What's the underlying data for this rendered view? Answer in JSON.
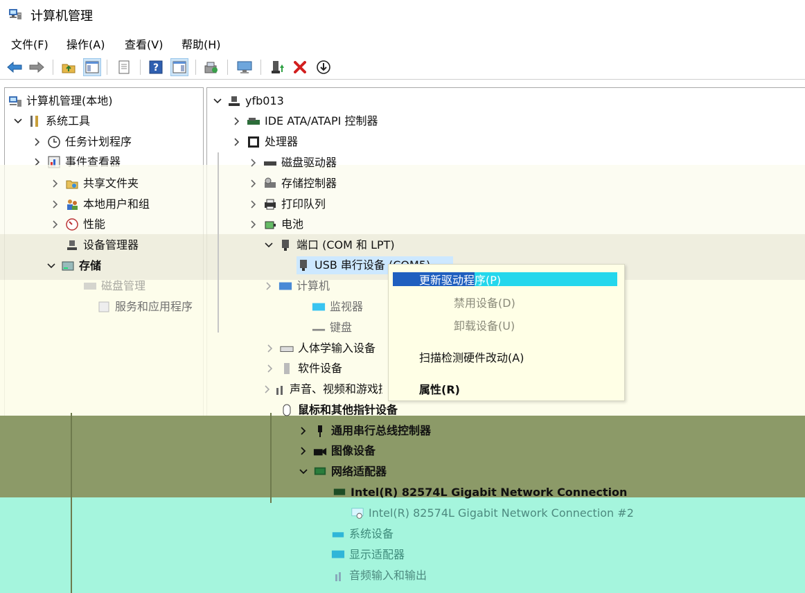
{
  "window": {
    "title": "计算机管理"
  },
  "menu": [
    "文件(F)",
    "操作(A)",
    "查看(V)",
    "帮助(H)"
  ],
  "toolbar": {
    "buttons": [
      "back-icon",
      "forward-icon",
      "up-folder-icon",
      "show-hide-tree-icon",
      "export-list-icon",
      "help-icon",
      "action-pane-icon",
      "scan-hardware-icon",
      "computer-monitor-icon",
      "update-driver-icon",
      "uninstall-icon",
      "disable-device-icon"
    ],
    "accent": "#1f6fbf",
    "delete_color": "#d21f1f"
  },
  "left_tree": [
    {
      "label": "计算机管理(本地)",
      "icon": "computer-management-icon",
      "level": 0,
      "expander": "none"
    },
    {
      "label": "系统工具",
      "icon": "tools-icon",
      "level": 1,
      "expander": "open"
    },
    {
      "label": "任务计划程序",
      "icon": "clock-icon",
      "level": 2,
      "expander": "closed"
    },
    {
      "label": "事件查看器",
      "icon": "event-viewer-icon",
      "level": 2,
      "expander": "closed"
    },
    {
      "label": "共享文件夹",
      "icon": "shared-folder-icon",
      "level": 2,
      "expander": "closed"
    },
    {
      "label": "本地用户和组",
      "icon": "users-icon",
      "level": 2,
      "expander": "closed"
    },
    {
      "label": "性能",
      "icon": "performance-icon",
      "level": 2,
      "expander": "closed"
    },
    {
      "label": "设备管理器",
      "icon": "device-manager-icon",
      "level": 2,
      "expander": "none"
    },
    {
      "label": "存储",
      "icon": "storage-icon",
      "level": 1,
      "expander": "open"
    },
    {
      "label": "磁盘管理",
      "icon": "disk-icon",
      "level": 2,
      "expander": "none"
    },
    {
      "label": "服务和应用程序",
      "icon": "services-icon",
      "level": 1,
      "expander": "closed"
    }
  ],
  "right_tree": [
    {
      "label": "yfb013",
      "icon": "computer-icon",
      "level": 0,
      "expander": "open"
    },
    {
      "label": "IDE ATA/ATAPI 控制器",
      "icon": "ide-controller-icon",
      "level": 1,
      "expander": "closed"
    },
    {
      "label": "处理器",
      "icon": "processor-icon",
      "level": 1,
      "expander": "closed"
    },
    {
      "label": "磁盘驱动器",
      "icon": "disk-drive-icon",
      "level": 1,
      "expander": "closed"
    },
    {
      "label": "存储控制器",
      "icon": "storage-controller-icon",
      "level": 1,
      "expander": "closed"
    },
    {
      "label": "打印队列",
      "icon": "printer-icon",
      "level": 1,
      "expander": "closed"
    },
    {
      "label": "电池",
      "icon": "battery-icon",
      "level": 1,
      "expander": "closed"
    },
    {
      "label": "端口 (COM 和 LPT)",
      "icon": "port-icon",
      "level": 1,
      "expander": "open"
    },
    {
      "label": "USB 串行设备 (COM5)",
      "icon": "usb-serial-icon",
      "level": 2,
      "expander": "none",
      "selected": true
    },
    {
      "label": "计算机",
      "icon": "computer-icon",
      "level": 1,
      "expander": "closed"
    },
    {
      "label": "监视器",
      "icon": "monitor-icon",
      "level": 1,
      "expander": "closed"
    },
    {
      "label": "键盘",
      "icon": "keyboard-icon",
      "level": 1,
      "expander": "closed"
    },
    {
      "label": "人体学输入设备",
      "icon": "hid-icon",
      "level": 1,
      "expander": "closed"
    },
    {
      "label": "软件设备",
      "icon": "software-device-icon",
      "level": 1,
      "expander": "closed"
    },
    {
      "label": "声音、视频和游戏控制器",
      "icon": "sound-icon",
      "level": 1,
      "expander": "closed"
    },
    {
      "label": "鼠标和其他指针设备",
      "icon": "mouse-icon",
      "level": 1,
      "expander": "closed"
    },
    {
      "label": "通用串行总线控制器",
      "icon": "usb-icon",
      "level": 1,
      "expander": "closed"
    },
    {
      "label": "图像设备",
      "icon": "camera-icon",
      "level": 1,
      "expander": "closed"
    },
    {
      "label": "网络适配器",
      "icon": "network-adapter-icon",
      "level": 1,
      "expander": "open"
    },
    {
      "label": "Intel(R) 82574L Gigabit Network Connection",
      "icon": "network-card-icon",
      "level": 2,
      "expander": "none"
    },
    {
      "label": "Intel(R) 82574L Gigabit Network Connection #2",
      "icon": "network-card-disabled-icon",
      "level": 2,
      "expander": "none"
    },
    {
      "label": "系统设备",
      "icon": "system-device-icon",
      "level": 1,
      "expander": "closed"
    },
    {
      "label": "显示适配器",
      "icon": "display-adapter-icon",
      "level": 1,
      "expander": "closed"
    },
    {
      "label": "音频输入和输出",
      "icon": "audio-icon",
      "level": 1,
      "expander": "closed"
    }
  ],
  "context_menu": [
    {
      "label": "更新驱动程序(P)",
      "highlighted": true
    },
    {
      "label": "禁用设备(D)"
    },
    {
      "label": "卸载设备(U)"
    },
    {
      "label": "扫描检测硬件改动(A)"
    },
    {
      "label": "属性(R)",
      "bold": true
    }
  ]
}
